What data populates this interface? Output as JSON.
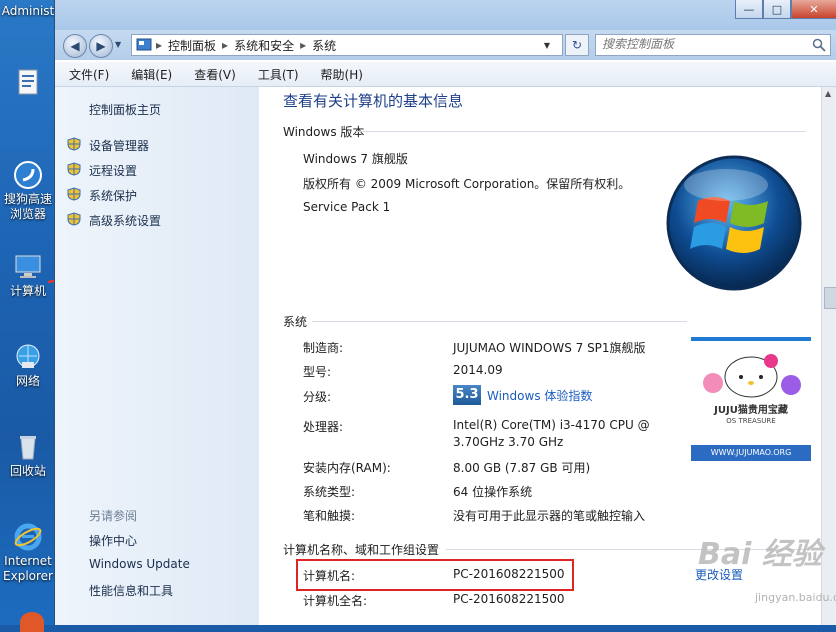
{
  "desktop": {
    "icons": [
      {
        "label": "Administ"
      },
      {
        "label": ""
      },
      {
        "label": "搜狗高速浏览器"
      },
      {
        "label": "计算机"
      },
      {
        "label": "网络"
      },
      {
        "label": "回收站"
      },
      {
        "label": "Internet Explorer"
      }
    ]
  },
  "window": {
    "minimize": "—",
    "maximize": "□",
    "close": "✕"
  },
  "address": {
    "crumbs": [
      "控制面板",
      "系统和安全",
      "系统"
    ],
    "search_placeholder": "搜索控制面板"
  },
  "menu": [
    "文件(F)",
    "编辑(E)",
    "查看(V)",
    "工具(T)",
    "帮助(H)"
  ],
  "left_pane": {
    "home": "控制面板主页",
    "tasks": [
      "设备管理器",
      "远程设置",
      "系统保护",
      "高级系统设置"
    ],
    "see_also_heading": "另请参阅",
    "see_also": [
      "操作中心",
      "Windows Update",
      "性能信息和工具"
    ]
  },
  "main": {
    "title": "查看有关计算机的基本信息",
    "edition_heading": "Windows 版本",
    "edition": "Windows 7 旗舰版",
    "copyright": "版权所有 © 2009 Microsoft Corporation。保留所有权利。",
    "service_pack": "Service Pack 1",
    "system_heading": "系统",
    "system_rows": [
      {
        "label": "制造商:",
        "value": "JUJUMAO WINDOWS 7 SP1旗舰版"
      },
      {
        "label": "型号:",
        "value": "2014.09"
      },
      {
        "label": "分级:",
        "value": ""
      },
      {
        "label": "处理器:",
        "value": "Intel(R) Core(TM) i3-4170 CPU @"
      },
      {
        "label": "",
        "value": "3.70GHz   3.70 GHz"
      },
      {
        "label": "安装内存(RAM):",
        "value": "8.00 GB (7.87 GB 可用)"
      },
      {
        "label": "系统类型:",
        "value": "64 位操作系统"
      },
      {
        "label": "笔和触摸:",
        "value": "没有可用于此显示器的笔或触控输入"
      }
    ],
    "wei_score": "5.3",
    "wei_link": "Windows 体验指数",
    "computer_heading": "计算机名称、域和工作组设置",
    "computer_rows": [
      {
        "label": "计算机名:",
        "value": "PC-201608221500"
      },
      {
        "label": "计算机全名:",
        "value": "PC-201608221500"
      }
    ],
    "change_settings": "更改设置",
    "oem_brand": "JUJU猫贵用宝藏",
    "oem_sub": "OS TREASURE",
    "oem_url": "WWW.JUJUMAO.ORG"
  },
  "watermark": {
    "brand": "Bai 经验",
    "url": "jingyan.baidu.com"
  },
  "colors": {
    "accent": "#1e3f8a",
    "link": "#1a5cbf",
    "highlight": "#e02424"
  }
}
